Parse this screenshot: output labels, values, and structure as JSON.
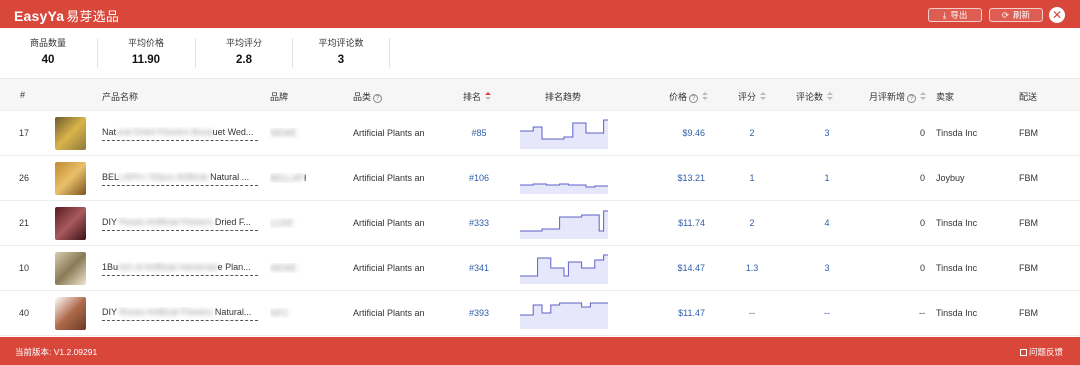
{
  "app": {
    "logo_en": "EasyYa",
    "logo_cn": "易芽选品"
  },
  "toolbar": {
    "export_icon": "download-icon",
    "export_label": "导出",
    "refresh_icon": "refresh-icon",
    "refresh_label": "刷新",
    "close_icon": "close-icon"
  },
  "stats": [
    {
      "label": "商品数量",
      "value": "40"
    },
    {
      "label": "平均价格",
      "value": "11.90"
    },
    {
      "label": "平均评分",
      "value": "2.8"
    },
    {
      "label": "平均评论数",
      "value": "3"
    }
  ],
  "columns": {
    "index": "#",
    "name": "产品名称",
    "brand": "品牌",
    "category": "品类",
    "rank": "排名",
    "trend": "排名趋势",
    "price": "价格",
    "rating": "评分",
    "reviews": "评论数",
    "monthly_new": "月评新增",
    "seller": "卖家",
    "fulfillment": "配送"
  },
  "help_icon": "question-circle-icon",
  "rows": [
    {
      "index": "17",
      "name_visible_a": "Nat",
      "name_blurred": "ural Dried Flowers Bouq",
      "name_visible_b": "uet Wed...",
      "brand_blurred": "NEWE",
      "brand_visible": "",
      "category": "Artificial Plants an",
      "rank": "#85",
      "price": "$9.46",
      "rating": "2",
      "reviews": "3",
      "monthly_new": "0",
      "seller": "Tinsda Inc",
      "fulfillment": "FBM",
      "thumb_colors": [
        "#6b5a2c",
        "#d9b44a",
        "#8f7a3a"
      ],
      "trend": [
        12,
        12,
        12,
        8,
        8,
        20,
        20,
        20,
        20,
        20,
        18,
        18,
        4,
        4,
        4,
        14,
        14,
        14,
        14,
        1
      ]
    },
    {
      "index": "26",
      "name_visible_a": "BEL",
      "name_blurred": "LAPH / 50pcs Artificial",
      "name_visible_b": " Natural ...",
      "brand_blurred": "BELLAP",
      "brand_visible": "H",
      "category": "Artificial Plants an",
      "rank": "#106",
      "price": "$13.21",
      "rating": "1",
      "reviews": "1",
      "monthly_new": "0",
      "seller": "Joybuy",
      "fulfillment": "FBM",
      "thumb_colors": [
        "#c28a2e",
        "#e8c06a",
        "#7a5420"
      ],
      "trend": [
        21,
        21,
        21,
        20,
        20,
        20,
        21,
        21,
        21,
        20,
        20,
        21,
        21,
        21,
        21,
        23,
        23,
        22,
        22,
        22
      ]
    },
    {
      "index": "21",
      "name_visible_a": "DIY",
      "name_blurred": " Roses Artificial Flowers",
      "name_visible_b": " Dried F...",
      "brand_blurred": "LUXE",
      "brand_visible": "",
      "category": "Artificial Plants an",
      "rank": "#333",
      "price": "$11.74",
      "rating": "2",
      "reviews": "4",
      "monthly_new": "0",
      "seller": "Tinsda Inc",
      "fulfillment": "FBM",
      "thumb_colors": [
        "#5a1a1e",
        "#a85a5e",
        "#3a1216"
      ],
      "trend": [
        22,
        22,
        22,
        22,
        22,
        20,
        20,
        20,
        20,
        8,
        8,
        8,
        8,
        8,
        6,
        6,
        6,
        6,
        22,
        2
      ]
    },
    {
      "index": "10",
      "name_visible_a": "1Bu",
      "name_blurred": "nch of Artificial Handmad",
      "name_visible_b": "e Plan...",
      "brand_blurred": "NEWE",
      "brand_visible": "",
      "category": "Artificial Plants an",
      "rank": "#341",
      "price": "$14.47",
      "rating": "1.3",
      "reviews": "3",
      "monthly_new": "0",
      "seller": "Tinsda Inc",
      "fulfillment": "FBM",
      "thumb_colors": [
        "#d8cdb2",
        "#8a7a56",
        "#efe6cf"
      ],
      "trend": [
        22,
        22,
        22,
        22,
        4,
        4,
        4,
        14,
        14,
        14,
        22,
        8,
        8,
        8,
        14,
        14,
        14,
        6,
        6,
        1
      ]
    },
    {
      "index": "40",
      "name_visible_a": "DIY",
      "name_blurred": " Roses Artificial Flowers",
      "name_visible_b": " Natural...",
      "brand_blurred": "NFC",
      "brand_visible": "",
      "category": "Artificial Plants an",
      "rank": "#393",
      "price": "$11.47",
      "rating": "--",
      "reviews": "--",
      "monthly_new": "--",
      "seller": "Tinsda Inc",
      "fulfillment": "FBM",
      "thumb_colors": [
        "#fff",
        "#b06a4a",
        "#6a3a2a"
      ],
      "trend": [
        16,
        16,
        16,
        6,
        6,
        14,
        14,
        6,
        6,
        4,
        4,
        4,
        4,
        4,
        8,
        8,
        4,
        4,
        4,
        4
      ]
    }
  ],
  "footer": {
    "version_label": "当前版本: V1.2.09291",
    "feedback_icon": "feedback-icon",
    "feedback_label": "问题反馈"
  },
  "colors": {
    "brand_red": "#d9473b",
    "link_blue": "#2f5da8",
    "spark_fill": "#e6e7fb",
    "spark_line": "#5e62c9"
  }
}
